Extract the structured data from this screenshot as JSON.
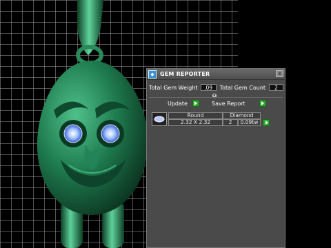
{
  "panel": {
    "title": "GEM REPORTER",
    "app_icon": "gem-reporter-icon",
    "close": "x"
  },
  "totals": {
    "weight_label": "Total Gem Weight",
    "weight_value": ".09",
    "count_label": "Total Gem Count",
    "count_value": "2"
  },
  "actions": {
    "update_label": "Update",
    "save_label": "Save Report"
  },
  "table": {
    "columns": [
      "Round",
      "Diamond"
    ],
    "rows": [
      {
        "size": "2.32 X 2.32",
        "count": "2",
        "weight": "0.09tw"
      }
    ]
  },
  "colors": {
    "model": "#1e7a4e",
    "button_arrow": "#2ea82e",
    "panel_bg": "#4a4a4a"
  }
}
